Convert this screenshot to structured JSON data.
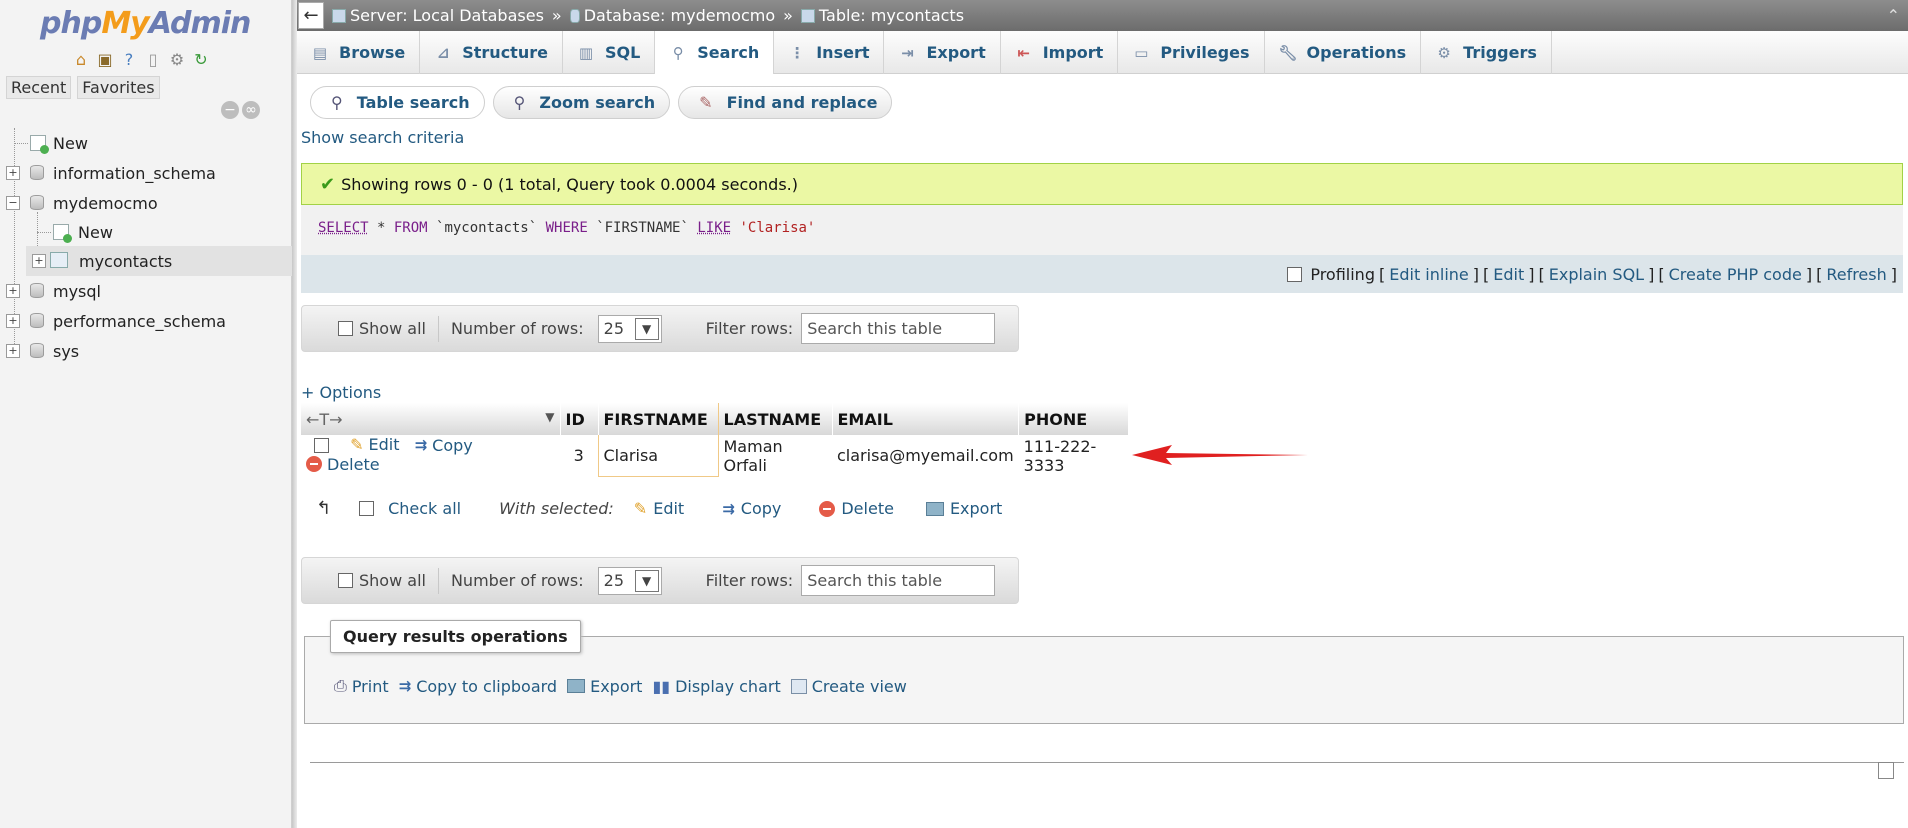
{
  "sidebar": {
    "logo": {
      "php": "php",
      "my": "My",
      "admin": "Admin"
    },
    "recent_label": "Recent",
    "favorites_label": "Favorites",
    "tree": [
      {
        "label": "New"
      },
      {
        "label": "information_schema"
      },
      {
        "label": "mydemocmo"
      },
      {
        "label": "New"
      },
      {
        "label": "mycontacts"
      },
      {
        "label": "mysql"
      },
      {
        "label": "performance_schema"
      },
      {
        "label": "sys"
      }
    ]
  },
  "breadcrumb": {
    "back": "←",
    "server": "Server: Local Databases",
    "database": "Database: mydemocmo",
    "table": "Table: mycontacts",
    "sep": "»"
  },
  "tabs": [
    {
      "label": "Browse"
    },
    {
      "label": "Structure"
    },
    {
      "label": "SQL"
    },
    {
      "label": "Search"
    },
    {
      "label": "Insert"
    },
    {
      "label": "Export"
    },
    {
      "label": "Import"
    },
    {
      "label": "Privileges"
    },
    {
      "label": "Operations"
    },
    {
      "label": "Triggers"
    }
  ],
  "subtabs": [
    {
      "label": "Table search"
    },
    {
      "label": "Zoom search"
    },
    {
      "label": "Find and replace"
    }
  ],
  "show_search_criteria": "Show search criteria",
  "message": "Showing rows 0 - 0 (1 total, Query took 0.0004 seconds.)",
  "sql": {
    "select": "SELECT",
    "star_from": " * ",
    "from": "FROM",
    "table": " `mycontacts` ",
    "where": "WHERE",
    "col": " `FIRSTNAME` ",
    "like": "LIKE",
    "value": " 'Clarisa'"
  },
  "profiling": {
    "label": "Profiling",
    "open": "[",
    "close": "]",
    "links": [
      "Edit inline",
      "Edit",
      "Explain SQL",
      "Create PHP code",
      "Refresh"
    ]
  },
  "navbar": {
    "show_all": "Show all",
    "rows_label": "Number of rows:",
    "rows_value": "25",
    "filter_label": "Filter rows:",
    "filter_placeholder": "Search this table"
  },
  "options_link": "+ Options",
  "table": {
    "columns": [
      "ID",
      "FIRSTNAME",
      "LASTNAME",
      "EMAIL",
      "PHONE"
    ],
    "row": {
      "id": "3",
      "firstname": "Clarisa",
      "lastname": "Maman Orfali",
      "email": "clarisa@myemail.com",
      "phone": "111-222-3333"
    },
    "actions": {
      "edit": "Edit",
      "copy": "Copy",
      "delete": "Delete"
    },
    "col_ctrl": "←T→"
  },
  "with_selected": {
    "check_all": "Check all",
    "label": "With selected:",
    "edit": "Edit",
    "copy": "Copy",
    "delete": "Delete",
    "export": "Export"
  },
  "query_ops": {
    "legend": "Query results operations",
    "print": "Print",
    "copy": "Copy to clipboard",
    "export": "Export",
    "chart": "Display chart",
    "view": "Create view"
  },
  "colors": {
    "link": "#235a81",
    "success_bg": "#ebf8a4",
    "arrow": "#e02020"
  }
}
